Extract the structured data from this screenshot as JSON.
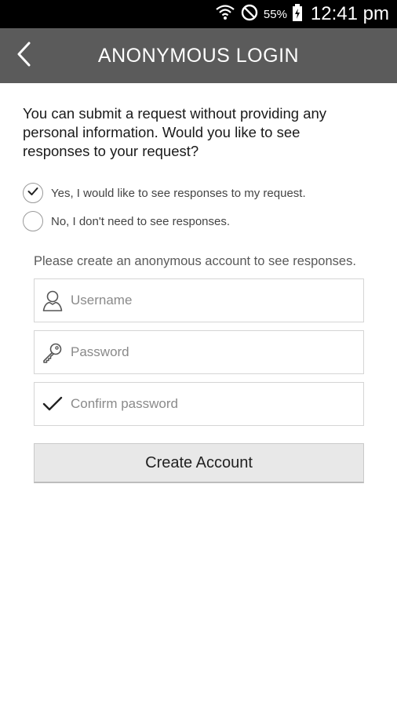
{
  "status_bar": {
    "icons": [
      "wifi-icon",
      "do-not-disturb-icon",
      "battery-icon"
    ],
    "battery_percent": "55%",
    "time": "12:41 pm"
  },
  "app_bar": {
    "back_icon": "chevron-left-icon",
    "title": "ANONYMOUS LOGIN",
    "background_color": "#5b5b5b"
  },
  "intro_text": "You can submit a request without providing any personal information. Would you like to see responses to your request?",
  "options": [
    {
      "label": "Yes, I would like to see responses to my request.",
      "checked": true
    },
    {
      "label": "No, I don't need to see responses.",
      "checked": false
    }
  ],
  "account_hint": "Please create an anonymous account to see responses.",
  "fields": {
    "username": {
      "placeholder": "Username",
      "value": "",
      "icon": "user-icon"
    },
    "password": {
      "placeholder": "Password",
      "value": "",
      "icon": "key-icon"
    },
    "confirm_password": {
      "placeholder": "Confirm password",
      "value": "",
      "icon": "checkmark-icon"
    }
  },
  "create_button_label": "Create Account"
}
